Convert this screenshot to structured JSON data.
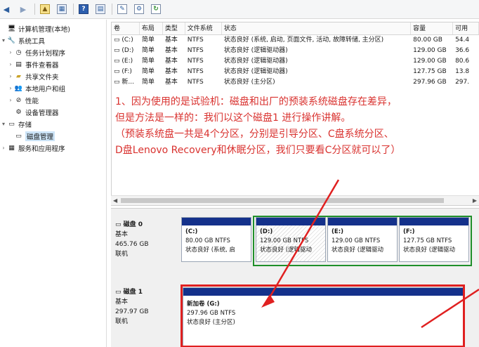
{
  "toolbar": {
    "buttons": [
      "back",
      "forward",
      "up-folder",
      "show-hide-tree",
      "help",
      "show-hide-action",
      "properties",
      "refresh",
      "disk-settings"
    ]
  },
  "tree": {
    "items": [
      {
        "label": "计算机管理(本地)",
        "icon": "computer-icon"
      },
      {
        "label": "系统工具",
        "icon": "tools-icon"
      },
      {
        "label": "任务计划程序",
        "icon": "clock-icon"
      },
      {
        "label": "事件查看器",
        "icon": "event-viewer-icon"
      },
      {
        "label": "共享文件夹",
        "icon": "shared-folder-icon"
      },
      {
        "label": "本地用户和组",
        "icon": "users-icon"
      },
      {
        "label": "性能",
        "icon": "performance-icon"
      },
      {
        "label": "设备管理器",
        "icon": "device-manager-icon"
      },
      {
        "label": "存储",
        "icon": "storage-icon"
      },
      {
        "label": "磁盘管理",
        "icon": "disk-management-icon"
      },
      {
        "label": "服务和应用程序",
        "icon": "services-icon"
      }
    ]
  },
  "volume_list": {
    "columns": [
      "卷",
      "布局",
      "类型",
      "文件系统",
      "状态",
      "容量",
      "可用"
    ],
    "rows": [
      {
        "vol": "(C:)",
        "layout": "简单",
        "type": "基本",
        "fs": "NTFS",
        "status": "状态良好 (系统, 启动, 页面文件, 活动, 故障转储, 主分区)",
        "capacity": "80.00 GB",
        "free": "54.4"
      },
      {
        "vol": "(D:)",
        "layout": "简单",
        "type": "基本",
        "fs": "NTFS",
        "status": "状态良好 (逻辑驱动器)",
        "capacity": "129.00 GB",
        "free": "36.6"
      },
      {
        "vol": "(E:)",
        "layout": "简单",
        "type": "基本",
        "fs": "NTFS",
        "status": "状态良好 (逻辑驱动器)",
        "capacity": "129.00 GB",
        "free": "80.6"
      },
      {
        "vol": "(F:)",
        "layout": "简单",
        "type": "基本",
        "fs": "NTFS",
        "status": "状态良好 (逻辑驱动器)",
        "capacity": "127.75 GB",
        "free": "13.8"
      },
      {
        "vol": "新...",
        "layout": "简单",
        "type": "基本",
        "fs": "NTFS",
        "status": "状态良好 (主分区)",
        "capacity": "297.96 GB",
        "free": "297."
      }
    ]
  },
  "annotation": {
    "line1": "1、因为使用的是试验机：磁盘和出厂的预装系统磁盘存在差异，",
    "line2": "但是方法是一样的：我们以这个磁盘1 进行操作讲解。",
    "line3": "（预装系统盘一共是4个分区，分别是引导分区、C盘系统分区、",
    "line4": "D盘Lenovo Recovery和休眠分区，我们只要看C分区就可以了）"
  },
  "disks": [
    {
      "name": "磁盘 0",
      "type": "基本",
      "size": "465.76 GB",
      "status": "联机",
      "partitions": [
        {
          "label": "(C:)",
          "size": "80.00 GB NTFS",
          "status": "状态良好 (系统, 启"
        },
        {
          "label": "(D:)",
          "size": "129.00 GB NTFS",
          "status": "状态良好 (逻辑驱动"
        },
        {
          "label": "(E:)",
          "size": "129.00 GB NTFS",
          "status": "状态良好 (逻辑驱动"
        },
        {
          "label": "(F:)",
          "size": "127.75 GB NTFS",
          "status": "状态良好 (逻辑驱动"
        }
      ]
    },
    {
      "name": "磁盘 1",
      "type": "基本",
      "size": "297.97 GB",
      "status": "联机",
      "partitions": [
        {
          "label": "新加卷 (G:)",
          "size": "297.96 GB NTFS",
          "status": "状态良好 (主分区)"
        }
      ]
    }
  ],
  "colors": {
    "partition_bar": "#14318b",
    "extended_border": "#1f8f2a",
    "highlight": "#e02020",
    "annotation_text": "#d9322f"
  }
}
